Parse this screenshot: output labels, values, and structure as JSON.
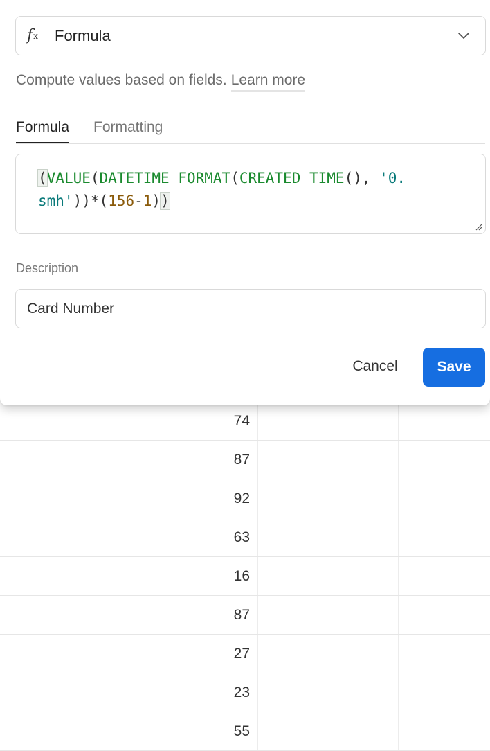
{
  "field_type": {
    "icon": "formula-icon",
    "label": "Formula"
  },
  "description_text": "Compute values based on fields.",
  "learn_more_label": "Learn more",
  "tabs": [
    {
      "label": "Formula",
      "active": true
    },
    {
      "label": "Formatting",
      "active": false
    }
  ],
  "formula": {
    "t1": "(",
    "t2": "VALUE",
    "t3": "(",
    "t4": "DATETIME_FORMAT",
    "t5": "(",
    "t6": "CREATED_TIME",
    "t7": "(), ",
    "t8": "'0.\nsmh'",
    "t9": "))*(",
    "t10": "156",
    "t11": "-",
    "t12": "1",
    "t13": ")",
    "t14": ")"
  },
  "description": {
    "label": "Description",
    "value": "Card Number"
  },
  "buttons": {
    "cancel": "Cancel",
    "save": "Save"
  },
  "colors": {
    "accent": "#166ee1",
    "function": "#1a8a2e",
    "string": "#0a7a7a",
    "number": "#8a5a0a"
  },
  "table_rows": [
    "74",
    "87",
    "92",
    "63",
    "16",
    "87",
    "27",
    "23",
    "55"
  ]
}
